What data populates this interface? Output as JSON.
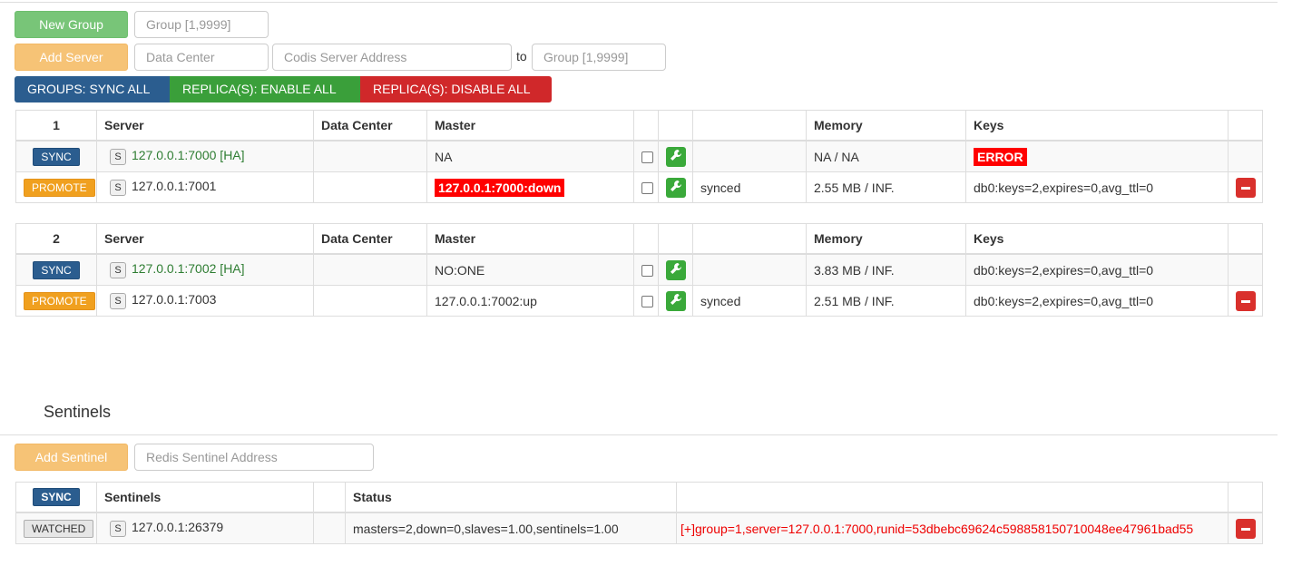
{
  "toolbar": {
    "new_group": "New Group",
    "group_placeholder": "Group [1,9999]",
    "add_server": "Add Server",
    "data_center_placeholder": "Data Center",
    "server_addr_placeholder": "Codis Server Address",
    "to_label": "to",
    "to_group_placeholder": "Group [1,9999]"
  },
  "bulk": {
    "sync_all": "GROUPS: SYNC ALL",
    "enable_all": "REPLICA(S): ENABLE ALL",
    "disable_all": "REPLICA(S): DISABLE ALL"
  },
  "colors": {
    "sync": "#2b5d8f",
    "promote": "#f0a01f",
    "enable": "#3a9f3a",
    "disable": "#d0282a",
    "error": "#ff0000"
  },
  "headers": {
    "server": "Server",
    "data_center": "Data Center",
    "master": "Master",
    "memory": "Memory",
    "keys": "Keys"
  },
  "groups": [
    {
      "id": "1",
      "rows": [
        {
          "action": "SYNC",
          "s": "S",
          "server": "127.0.0.1:7000 [HA]",
          "data_center": "",
          "master": "NA",
          "status": "",
          "memory": "NA / NA",
          "keys": "ERROR"
        },
        {
          "action": "PROMOTE",
          "s": "S",
          "server": "127.0.0.1:7001",
          "data_center": "",
          "master": "127.0.0.1:7000:down",
          "status": "synced",
          "memory": "2.55 MB / INF.",
          "keys": "db0:keys=2,expires=0,avg_ttl=0"
        }
      ]
    },
    {
      "id": "2",
      "rows": [
        {
          "action": "SYNC",
          "s": "S",
          "server": "127.0.0.1:7002 [HA]",
          "data_center": "",
          "master": "NO:ONE",
          "status": "",
          "memory": "3.83 MB / INF.",
          "keys": "db0:keys=2,expires=0,avg_ttl=0"
        },
        {
          "action": "PROMOTE",
          "s": "S",
          "server": "127.0.0.1:7003",
          "data_center": "",
          "master": "127.0.0.1:7002:up",
          "status": "synced",
          "memory": "2.51 MB / INF.",
          "keys": "db0:keys=2,expires=0,avg_ttl=0"
        }
      ]
    }
  ],
  "sentinels": {
    "title": "Sentinels",
    "add_button": "Add Sentinel",
    "address_placeholder": "Redis Sentinel Address",
    "sync": "SYNC",
    "col_sentinels": "Sentinels",
    "col_status": "Status",
    "rows": [
      {
        "action": "WATCHED",
        "s": "S",
        "address": "127.0.0.1:26379",
        "status": "masters=2,down=0,slaves=1.00,sentinels=1.00",
        "detail": "[+]group=1,server=127.0.0.1:7000,runid=53dbebc69624c598858150710048ee47961bad55"
      }
    ]
  }
}
